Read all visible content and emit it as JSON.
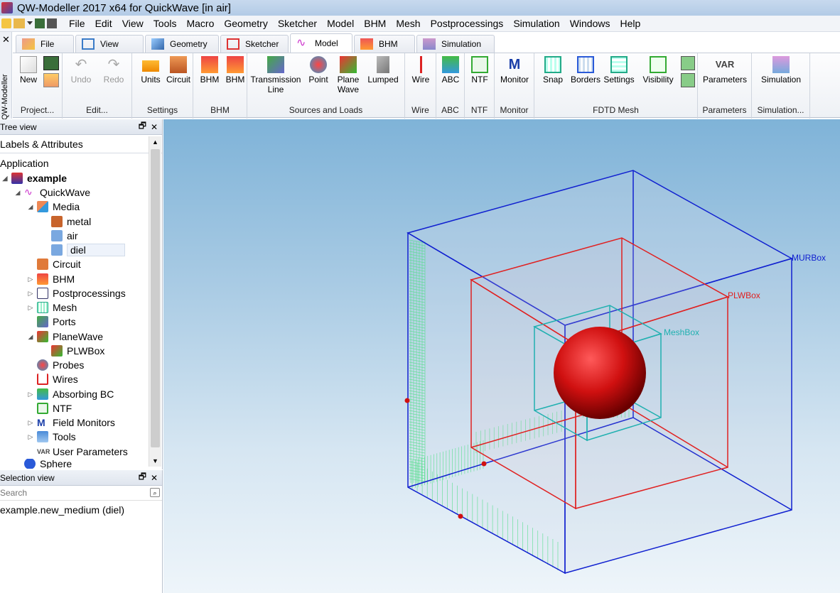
{
  "window": {
    "title": "QW-Modeller 2017 x64 for QuickWave [in air]"
  },
  "menu": [
    "File",
    "Edit",
    "View",
    "Tools",
    "Macro",
    "Geometry",
    "Sketcher",
    "Model",
    "BHM",
    "Mesh",
    "Postprocessings",
    "Simulation",
    "Windows",
    "Help"
  ],
  "strip_label": "QW-Modeller",
  "tabs": [
    "File",
    "View",
    "Geometry",
    "Sketcher",
    "Model",
    "BHM",
    "Simulation"
  ],
  "ribbon": {
    "new": "New",
    "undo": "Undo",
    "redo": "Redo",
    "units": "Units",
    "circuit": "Circuit",
    "bhm1": "BHM",
    "bhm2": "BHM",
    "transmission_line": "Transmission Line",
    "point": "Point",
    "plane_wave": "Plane Wave",
    "lumped": "Lumped",
    "wire": "Wire",
    "abc": "ABC",
    "ntf": "NTF",
    "monitor": "Monitor",
    "snap": "Snap",
    "borders": "Borders",
    "settings": "Settings",
    "visibility": "Visibility",
    "parameters": "Parameters",
    "simulation": "Simulation",
    "groups": {
      "project": "Project...",
      "edit": "Edit...",
      "settings": "Settings",
      "bhm": "BHM",
      "sources": "Sources and Loads",
      "wire": "Wire",
      "abc": "ABC",
      "ntf": "NTF",
      "monitor": "Monitor",
      "fdtd": "FDTD Mesh",
      "parameters": "Parameters",
      "simulation": "Simulation..."
    }
  },
  "tree": {
    "panel_title": "Tree view",
    "column": "Labels & Attributes",
    "root": "Application",
    "items": [
      "example",
      "QuickWave",
      "Media",
      "metal",
      "air",
      "diel",
      "Circuit",
      "BHM",
      "Postprocessings",
      "Mesh",
      "Ports",
      "PlaneWave",
      "PLWBox",
      "Probes",
      "Wires",
      "Absorbing BC",
      "NTF",
      "Field Monitors",
      "Tools",
      "User Parameters",
      "Sphere"
    ],
    "user_params_badge": "VAR"
  },
  "selection": {
    "panel_title": "Selection view",
    "search_placeholder": "Search",
    "value": "example.new_medium (diel)"
  },
  "scene": {
    "labels": {
      "mur": "MURBox",
      "plw": "PLWBox",
      "mesh": "MeshBox"
    }
  },
  "colors": {
    "mur": "#1020d0",
    "plw": "#e02020",
    "mesh": "#20b0b0",
    "sphere": "#d01010",
    "grid": "#30e070"
  }
}
